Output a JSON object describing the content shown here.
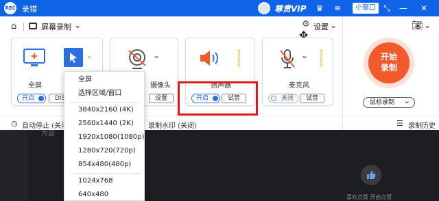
{
  "app": {
    "title": "录猎",
    "logo_text": "REC",
    "vip_label": "尊贵VIP",
    "mini_window": "小窗口"
  },
  "header": {
    "screen_record": "屏幕录制",
    "settings": "设置"
  },
  "cards": {
    "fullscreen": {
      "label": "全屏",
      "toggle": "开启",
      "button": "DISP"
    },
    "webcam": {
      "label": "摄像头",
      "button": "设置"
    },
    "speaker": {
      "label": "扬声器",
      "toggle": "开启",
      "button": "试音"
    },
    "mic": {
      "label": "麦克风",
      "toggle": "关闭",
      "button": "试音"
    }
  },
  "record_button": {
    "line1": "开始",
    "line2": "录制"
  },
  "mouse_record": {
    "selected": "鼠标录制"
  },
  "footer": {
    "auto_stop": "自动停止 (关闭)",
    "watermark": "录制水印 (关闭)",
    "history": "录制历史"
  },
  "dropdown": {
    "items": [
      "全屏",
      "选择区域/窗口",
      "3840x2160 (4K)",
      "2560x1440 (2K)",
      "1920x1080(1080p)",
      "1280x720(720p)",
      "854x480(480p)",
      "1024x768",
      "640x480"
    ]
  },
  "background": {
    "text": "为益",
    "like_caption": "喜欢点赞   开启点赞"
  },
  "colors": {
    "titlebar": "#0f63e6",
    "accent": "#2b6fe0",
    "record": "#f25a2c",
    "highlight": "#e0191a"
  }
}
